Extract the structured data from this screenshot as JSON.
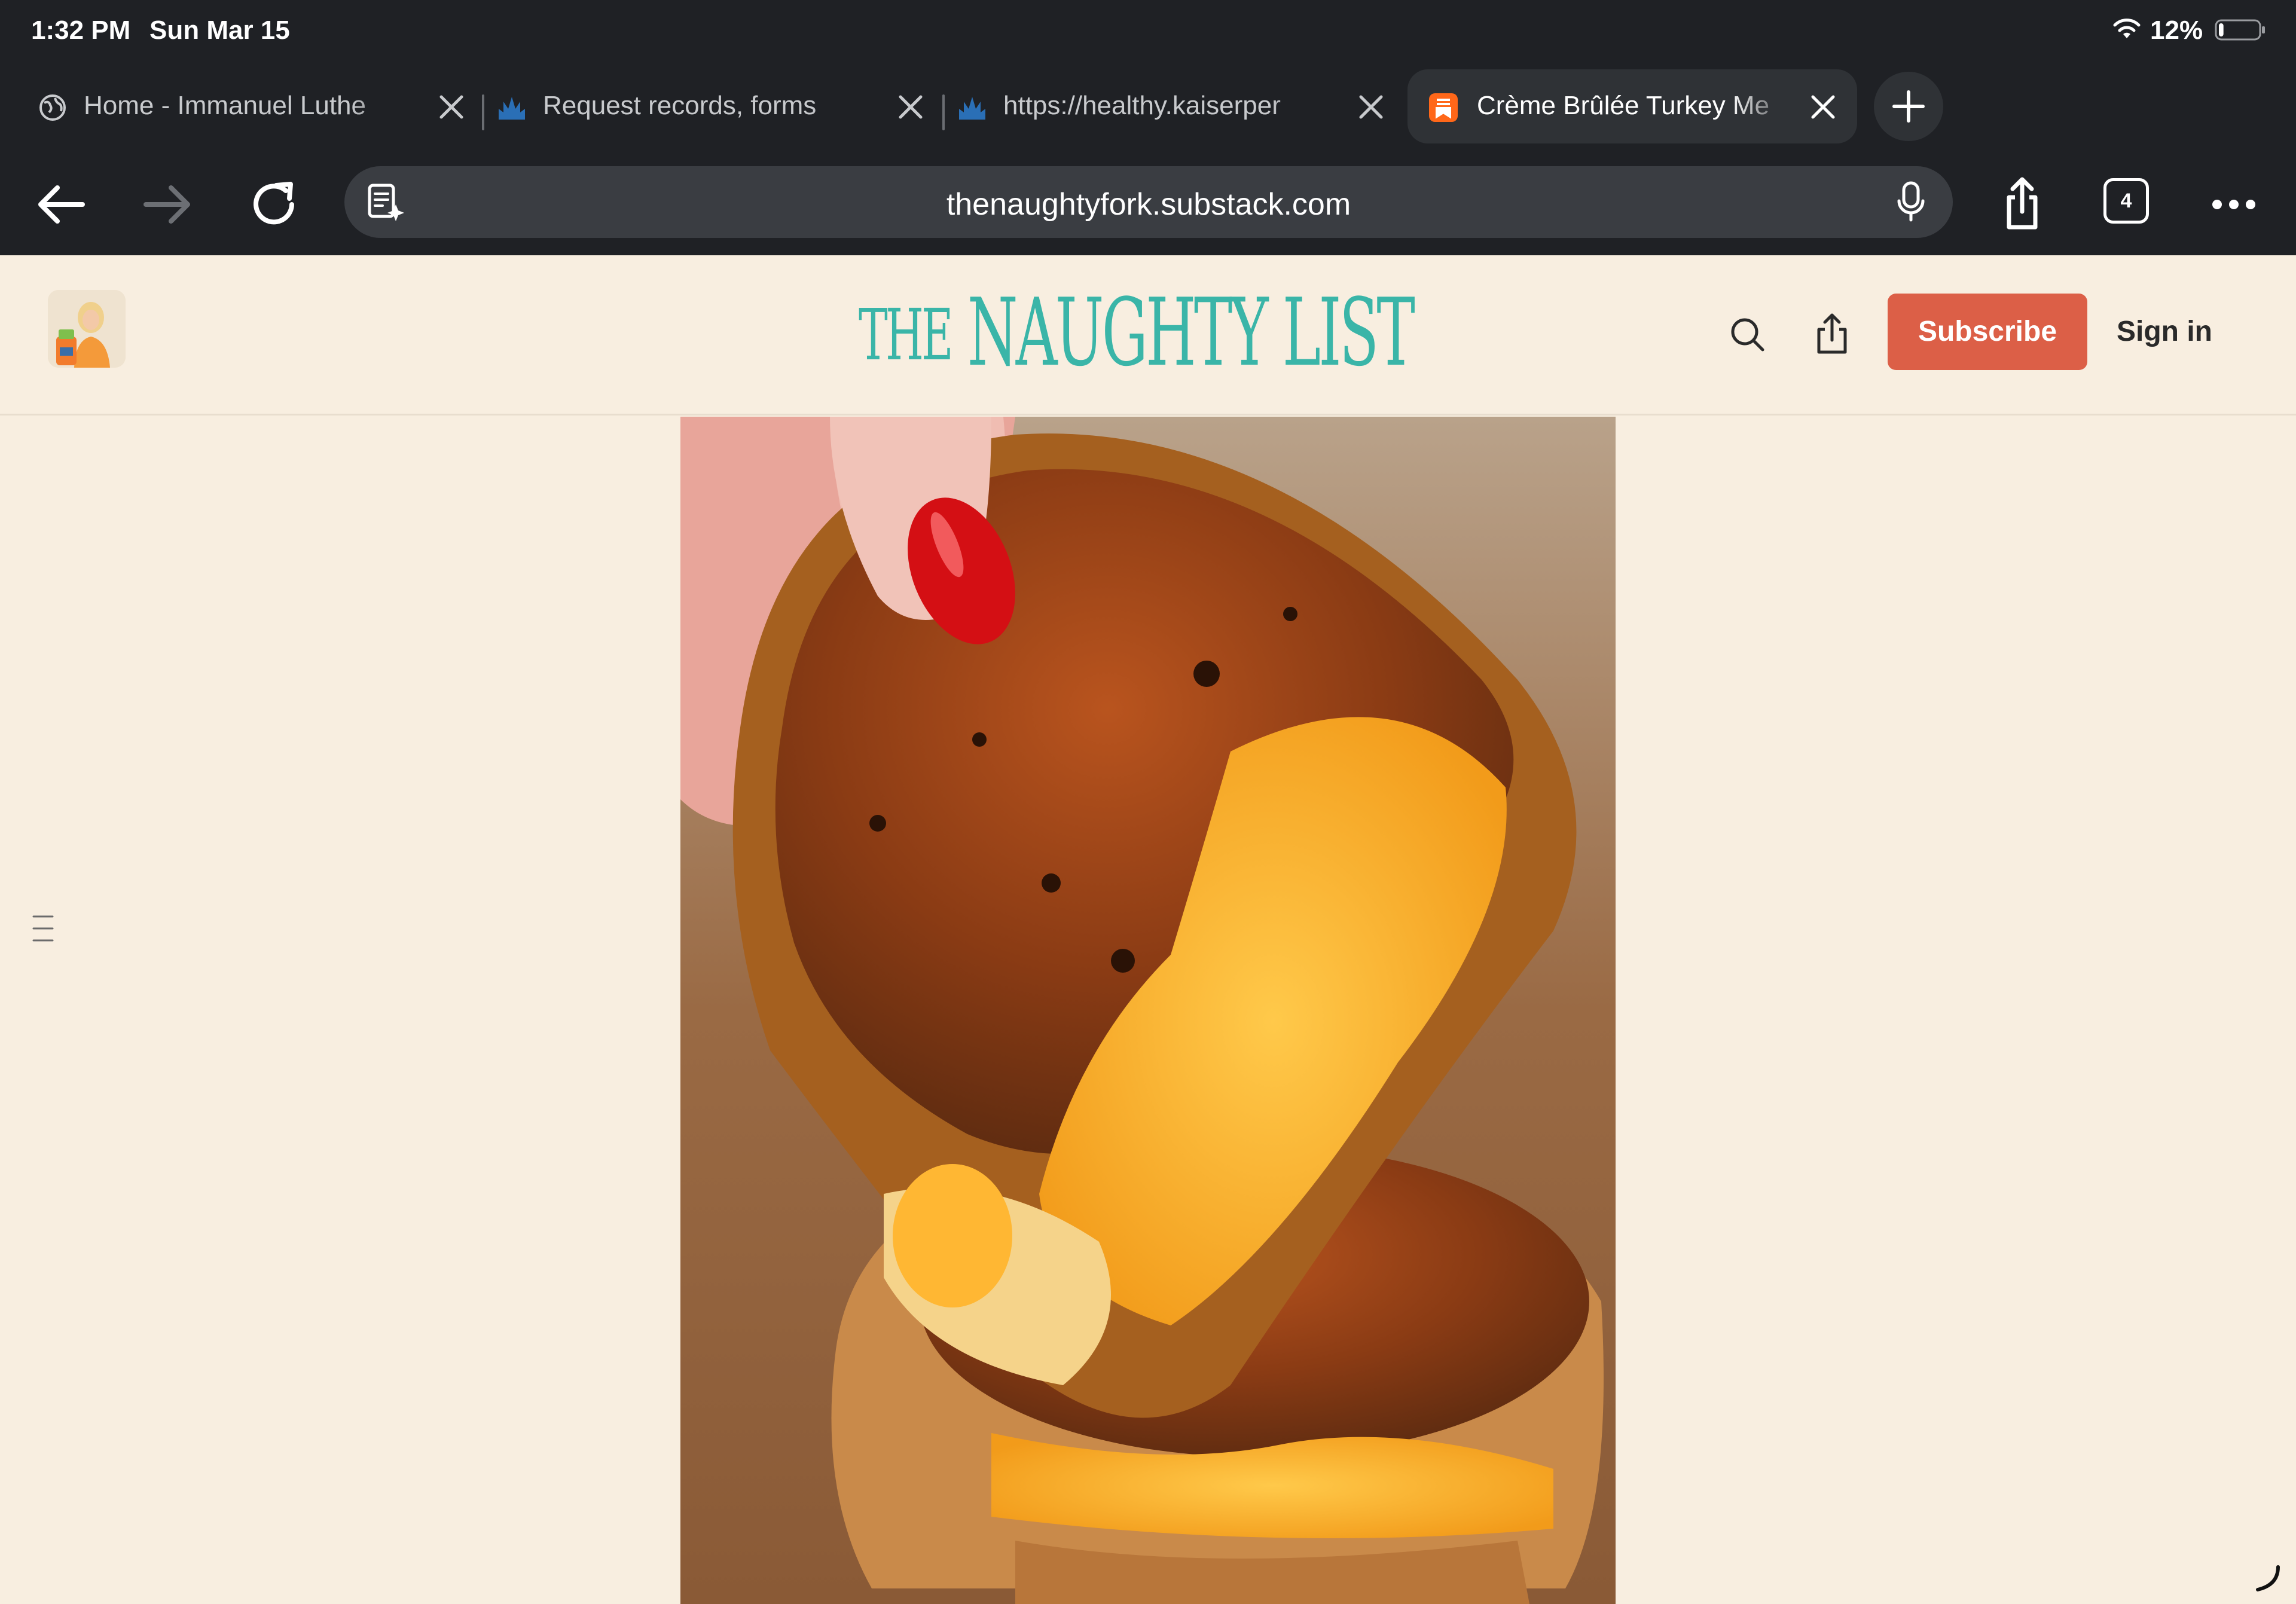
{
  "status_bar": {
    "time": "1:32 PM",
    "date": "Sun Mar 15",
    "battery_percent": "12%",
    "battery_level": 0.12
  },
  "tabs": [
    {
      "title": "Home - Immanuel Luthe",
      "icon": "globe-icon",
      "active": false
    },
    {
      "title": "Request records, forms",
      "icon": "kaiser-logo-icon",
      "active": false
    },
    {
      "title": "https://healthy.kaiserper",
      "icon": "kaiser-logo-icon",
      "active": false
    },
    {
      "title": "Crème Brûlée Turkey Me",
      "icon": "substack-icon",
      "active": true
    }
  ],
  "toolbar": {
    "url": "thenaughtyfork.substack.com",
    "tab_count": "4"
  },
  "site": {
    "logo_text_the": "THE",
    "logo_text_main": "NAUGHTY LIST",
    "subscribe_label": "Subscribe",
    "signin_label": "Sign in"
  },
  "colors": {
    "chrome_bg": "#1f2125",
    "page_bg": "#f8eee0",
    "logo_teal": "#3ab5a8",
    "subscribe_bg": "#dc5f47",
    "substack_orange": "#ff6719",
    "kaiser_blue": "#2a6fb6"
  }
}
